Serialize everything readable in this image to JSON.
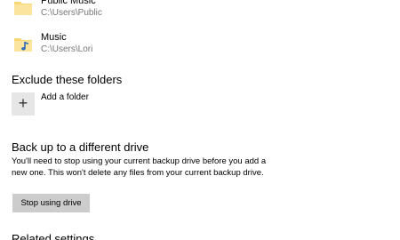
{
  "folders": [
    {
      "name": "Public Music",
      "path": "C:\\Users\\Public",
      "icon": "folder-icon"
    },
    {
      "name": "Music",
      "path": "C:\\Users\\Lori",
      "icon": "music-folder-icon"
    }
  ],
  "exclude": {
    "heading": "Exclude these folders",
    "add_label": "Add a folder",
    "add_glyph": "+"
  },
  "backup_drive": {
    "heading": "Back up to a different drive",
    "description": "You'll need to stop using your current backup drive before you add a new one. This won't delete any files from your current backup drive.",
    "button_label": "Stop using drive"
  },
  "related": {
    "heading": "Related settings"
  },
  "colors": {
    "folder_yellow": "#f8d775",
    "music_note": "#2b6ab8",
    "button_gray": "#cccccc",
    "tile_gray": "#e6e6e6",
    "path_gray": "#767676"
  }
}
